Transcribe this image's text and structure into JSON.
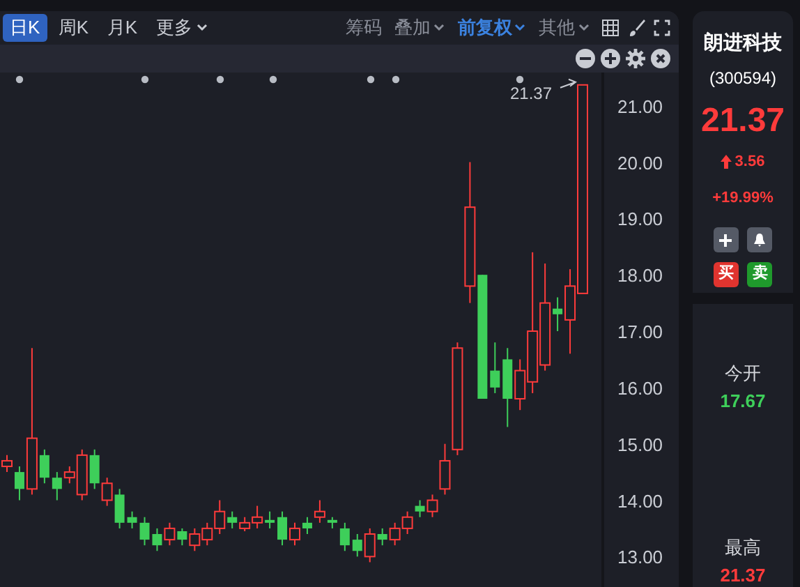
{
  "period_tabs": [
    {
      "label": "日K",
      "selected": true,
      "dropdown": false
    },
    {
      "label": "周K",
      "selected": false,
      "dropdown": false
    },
    {
      "label": "月K",
      "selected": false,
      "dropdown": false
    },
    {
      "label": "更多",
      "selected": false,
      "dropdown": true
    }
  ],
  "tools": [
    {
      "label": "筹码",
      "selected": false,
      "dropdown": false
    },
    {
      "label": "叠加",
      "selected": false,
      "dropdown": true
    },
    {
      "label": "前复权",
      "selected": true,
      "dropdown": true
    },
    {
      "label": "其他",
      "selected": false,
      "dropdown": true
    }
  ],
  "chart": {
    "price_marker": "21.37",
    "chart_data": {
      "type": "candlestick",
      "ohlc": [
        [
          14.6,
          14.8,
          14.5,
          14.7
        ],
        [
          14.5,
          14.6,
          14.0,
          14.2
        ],
        [
          14.2,
          16.7,
          14.1,
          15.1
        ],
        [
          14.8,
          14.9,
          14.3,
          14.4
        ],
        [
          14.4,
          14.5,
          14.0,
          14.2
        ],
        [
          14.4,
          14.6,
          14.3,
          14.5
        ],
        [
          14.1,
          14.9,
          14.0,
          14.8
        ],
        [
          14.8,
          14.9,
          14.2,
          14.3
        ],
        [
          14.0,
          14.4,
          13.9,
          14.3
        ],
        [
          14.1,
          14.2,
          13.5,
          13.6
        ],
        [
          13.7,
          13.8,
          13.5,
          13.6
        ],
        [
          13.6,
          13.7,
          13.2,
          13.3
        ],
        [
          13.4,
          13.5,
          13.1,
          13.2
        ],
        [
          13.3,
          13.6,
          13.2,
          13.5
        ],
        [
          13.45,
          13.5,
          13.2,
          13.3
        ],
        [
          13.2,
          13.5,
          13.1,
          13.4
        ],
        [
          13.3,
          13.6,
          13.2,
          13.5
        ],
        [
          13.5,
          14.0,
          13.4,
          13.8
        ],
        [
          13.7,
          13.8,
          13.5,
          13.6
        ],
        [
          13.5,
          13.7,
          13.45,
          13.6
        ],
        [
          13.6,
          13.9,
          13.5,
          13.7
        ],
        [
          13.65,
          13.8,
          13.5,
          13.6
        ],
        [
          13.7,
          13.8,
          13.2,
          13.3
        ],
        [
          13.3,
          13.6,
          13.2,
          13.5
        ],
        [
          13.6,
          13.7,
          13.4,
          13.5
        ],
        [
          13.7,
          14.0,
          13.6,
          13.8
        ],
        [
          13.65,
          13.7,
          13.5,
          13.6
        ],
        [
          13.5,
          13.6,
          13.1,
          13.2
        ],
        [
          13.3,
          13.4,
          13.0,
          13.1
        ],
        [
          13.0,
          13.5,
          12.9,
          13.4
        ],
        [
          13.4,
          13.5,
          13.2,
          13.3
        ],
        [
          13.3,
          13.6,
          13.2,
          13.5
        ],
        [
          13.5,
          13.8,
          13.4,
          13.7
        ],
        [
          13.9,
          14.0,
          13.7,
          13.8
        ],
        [
          13.8,
          14.1,
          13.7,
          14.0
        ],
        [
          14.2,
          15.0,
          14.1,
          14.7
        ],
        [
          14.9,
          16.8,
          14.8,
          16.7
        ],
        [
          17.8,
          20.0,
          17.5,
          19.2
        ],
        [
          18.0,
          18.0,
          15.8,
          15.8
        ],
        [
          16.3,
          16.8,
          15.9,
          16.0
        ],
        [
          16.5,
          16.7,
          15.3,
          15.8
        ],
        [
          15.8,
          16.5,
          15.6,
          16.3
        ],
        [
          16.1,
          18.4,
          15.9,
          17.0
        ],
        [
          16.4,
          18.2,
          16.3,
          17.5
        ],
        [
          17.4,
          17.6,
          17.0,
          17.3
        ],
        [
          17.2,
          18.1,
          16.6,
          17.8
        ],
        [
          17.67,
          21.37,
          17.67,
          21.37
        ]
      ],
      "ylim": [
        12.46,
        21.59
      ],
      "yticks": [
        {
          "value": 21,
          "label": "21.00"
        },
        {
          "value": 20,
          "label": "20.00"
        },
        {
          "value": 19,
          "label": "19.00"
        },
        {
          "value": 18,
          "label": "18.00"
        },
        {
          "value": 17,
          "label": "17.00"
        },
        {
          "value": 16,
          "label": "16.00"
        },
        {
          "value": 15,
          "label": "15.00"
        },
        {
          "value": 14,
          "label": "14.00"
        },
        {
          "value": 13,
          "label": "13.00"
        }
      ]
    }
  },
  "quote": {
    "name": "朗进科技",
    "code": "(300594)",
    "price": "21.37",
    "change": "3.56",
    "change_pct": "+19.99%",
    "buy": "买",
    "sell": "卖"
  },
  "stats": [
    {
      "label": "今开",
      "value": "17.67",
      "color": "#3ecf5a"
    },
    {
      "label": "最高",
      "value": "21.37",
      "color": "#ff3b3b"
    }
  ]
}
